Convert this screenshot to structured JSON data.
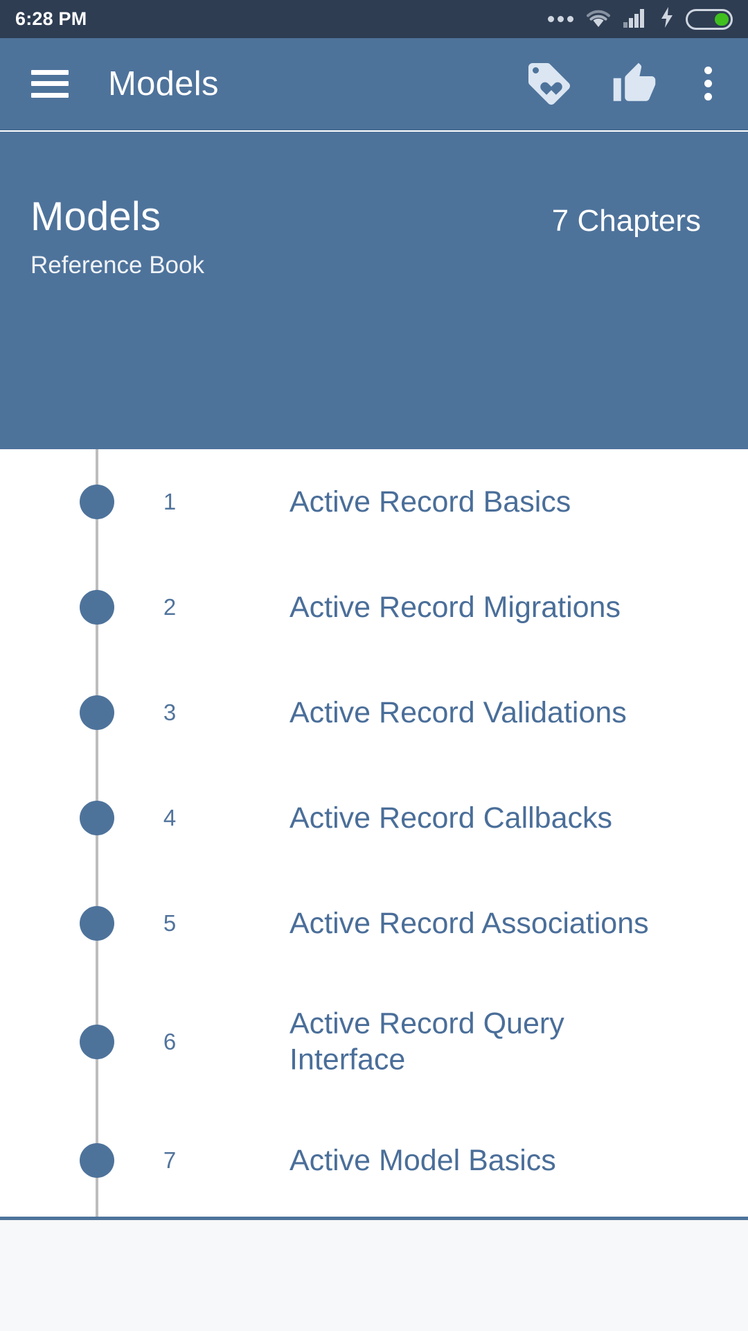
{
  "status_bar": {
    "time": "6:28 PM",
    "icons": {
      "more": "more-dots-icon",
      "wifi": "wifi-icon",
      "signal": "cellular-signal-icon",
      "charging": "charging-bolt-icon",
      "battery": "battery-icon"
    },
    "background_color": "#2e3d52",
    "battery_fill_color": "#3fc01f"
  },
  "toolbar": {
    "menu_icon": "hamburger-menu-icon",
    "title": "Models",
    "actions": [
      {
        "name": "loyalty-tag-icon",
        "label": "Loyalty"
      },
      {
        "name": "thumb-up-icon",
        "label": "Like"
      },
      {
        "name": "overflow-menu-icon",
        "label": "More options"
      }
    ],
    "background_color": "#4e739b"
  },
  "hero": {
    "title": "Models",
    "subtitle": "Reference Book",
    "chapter_count": "7 Chapters",
    "background_color": "#4e739b",
    "text_color": "#ffffff"
  },
  "chapter_list": {
    "accent_color": "#4e739b",
    "rail_color": "#bdbdbd",
    "title_color": "#4a6e99",
    "items": [
      {
        "number": "1",
        "title": "Active Record Basics"
      },
      {
        "number": "2",
        "title": "Active Record Migrations"
      },
      {
        "number": "3",
        "title": "Active Record Validations"
      },
      {
        "number": "4",
        "title": "Active Record Callbacks"
      },
      {
        "number": "5",
        "title": "Active Record Associations"
      },
      {
        "number": "6",
        "title": "Active Record Query Interface"
      },
      {
        "number": "7",
        "title": "Active Model Basics"
      }
    ]
  },
  "footer": {
    "divider_color": "#4e739b",
    "background_color": "#f7f8f9"
  }
}
